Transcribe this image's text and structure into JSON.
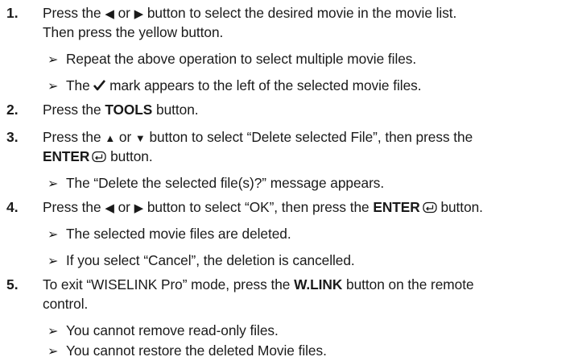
{
  "steps": [
    {
      "number": "1.",
      "line1": {
        "a": "Press the ",
        "b": " or ",
        "c": " button to select the desired movie in the movie list."
      },
      "line2": "Then press the yellow button.",
      "notes": [
        "Repeat the above operation to select multiple movie files.",
        {
          "a": "The ",
          "b": " mark appears to the left of the selected movie files."
        }
      ]
    },
    {
      "number": "2.",
      "line1": {
        "a": "Press the ",
        "bold": "TOOLS",
        "c": " button."
      }
    },
    {
      "number": "3.",
      "line1": {
        "a": "Press the ",
        "b": " or ",
        "c": " button to select “Delete selected File”, then press the"
      },
      "line2": {
        "bold": "ENTER",
        "c": " button."
      },
      "notes": [
        "The “Delete the selected file(s)?” message appears."
      ]
    },
    {
      "number": "4.",
      "line1": {
        "a": "Press the ",
        "b": " or ",
        "c": " button to select “OK”, then press the ",
        "bold": "ENTER",
        "d": " button."
      },
      "notes": [
        "The selected movie files are deleted.",
        "If you select “Cancel”, the deletion is cancelled."
      ]
    },
    {
      "number": "5.",
      "line1": {
        "a": "To exit “WISELINK Pro” mode, press the ",
        "bold": "W.LINK",
        "c": " button on the remote"
      },
      "line2": "control.",
      "notes": [
        "You cannot remove read-only files.",
        "You cannot restore the deleted Movie files."
      ]
    }
  ],
  "icons": {
    "left": "left-triangle-icon",
    "right": "right-triangle-icon",
    "up": "up-triangle-icon",
    "down": "down-triangle-icon",
    "check": "check-mark-icon",
    "enter": "enter-icon",
    "note": "note-arrow-icon"
  }
}
